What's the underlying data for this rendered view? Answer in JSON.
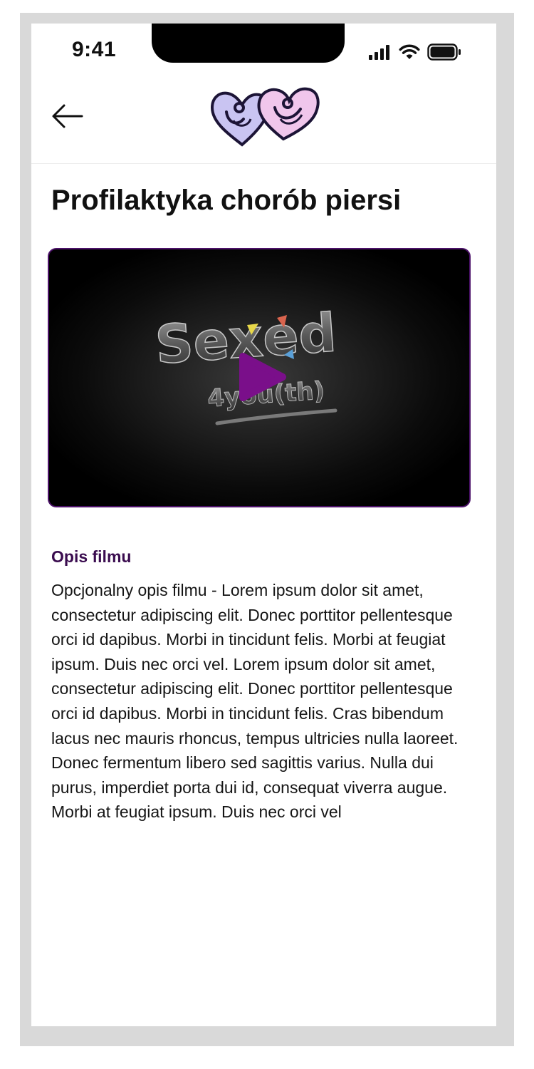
{
  "status_bar": {
    "time": "9:41",
    "icons": [
      "signal-icon",
      "wifi-icon",
      "battery-icon"
    ]
  },
  "header": {
    "back_icon": "arrow-left-icon",
    "logo": "hearts-logo"
  },
  "page": {
    "title": "Profilaktyka chorób piersi"
  },
  "video": {
    "thumbnail_text": "Sexed 4you(th)",
    "thumbnail_text_main": "Sexed",
    "thumbnail_text_sub": "4you(th)",
    "play_icon": "play-icon",
    "accent_color": "#7a0f8a",
    "border_color": "#4b1168"
  },
  "description": {
    "heading": "Opis filmu",
    "text": "Opcjonalny opis filmu - Lorem ipsum dolor sit amet, consectetur adipiscing elit. Donec porttitor pellentesque orci id dapibus. Morbi in tincidunt felis. Morbi at feugiat ipsum. Duis nec orci vel. Lorem ipsum dolor sit amet, consectetur adipiscing elit. Donec porttitor pellentesque orci id dapibus. Morbi in tincidunt felis. Cras bibendum lacus nec mauris rhoncus, tempus ultricies nulla laoreet. Donec fermentum libero sed sagittis varius. Nulla dui purus, imperdiet porta dui id, consequat viverra augue. Morbi at feugiat ipsum. Duis nec orci vel"
  }
}
